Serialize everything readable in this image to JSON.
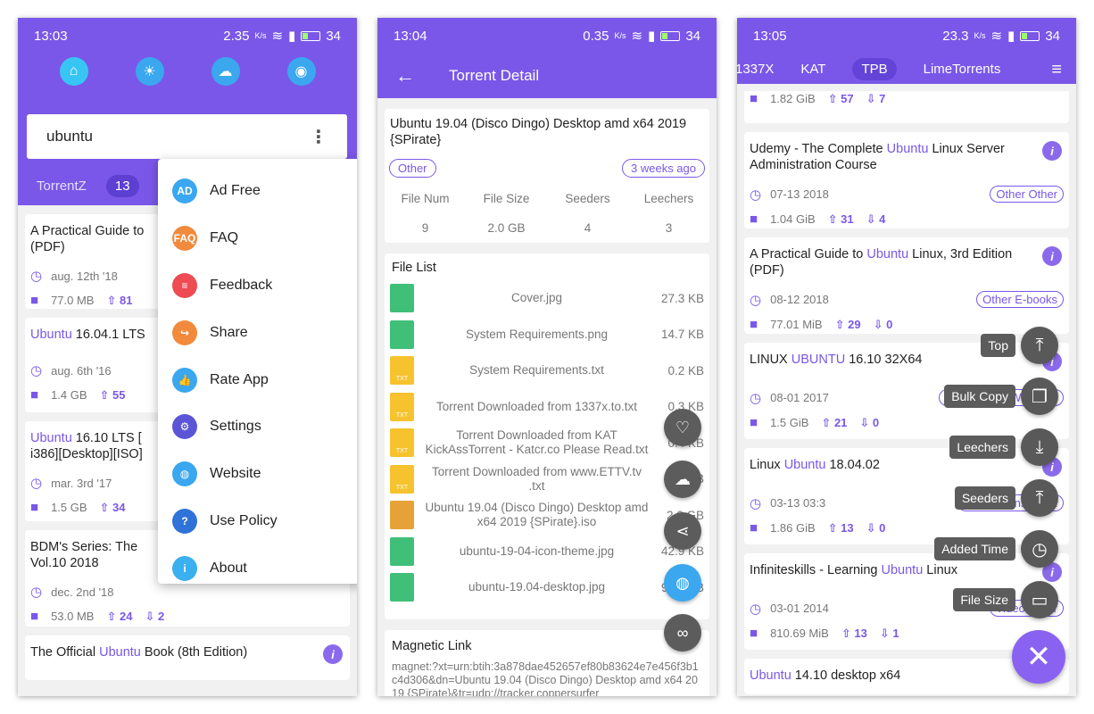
{
  "colors": {
    "primary": "#7a57e8",
    "accent": "#8a62f2",
    "fab_dark": "#595959"
  },
  "phone1": {
    "status": {
      "time": "13:03",
      "speed": "2.35",
      "speed_unit": "K/s",
      "battery": "34"
    },
    "top_icons": [
      "home-icon",
      "sun-icon",
      "weather-icon",
      "rss-icon"
    ],
    "search": {
      "value": "ubuntu"
    },
    "tabs": [
      {
        "label": "TorrentZ"
      },
      {
        "label": "13"
      }
    ],
    "menu": [
      {
        "label": "Ad Free",
        "icon": "ad-free-icon"
      },
      {
        "label": "FAQ",
        "icon": "faq-icon"
      },
      {
        "label": "Feedback",
        "icon": "feedback-icon"
      },
      {
        "label": "Share",
        "icon": "share-icon"
      },
      {
        "label": "Rate App",
        "icon": "rate-icon"
      },
      {
        "label": "Settings",
        "icon": "settings-icon"
      },
      {
        "label": "Website",
        "icon": "globe-icon"
      },
      {
        "label": "Use Policy",
        "icon": "help-icon"
      },
      {
        "label": "About",
        "icon": "about-icon"
      }
    ],
    "results": [
      {
        "title_pre": "A Practical Guide to",
        "title_hl": "",
        "title_post": "",
        "title2": "(PDF)",
        "date": "aug. 12th '18",
        "size": "77.0 MB",
        "seeds": "81",
        "leech": ""
      },
      {
        "title_pre": "",
        "title_hl": "Ubuntu",
        "title_post": " 16.04.1 LTS",
        "title2": "",
        "date": "aug. 6th '16",
        "size": "1.4 GB",
        "seeds": "55",
        "leech": ""
      },
      {
        "title_pre": "",
        "title_hl": "Ubuntu",
        "title_post": " 16.10 LTS [",
        "title2": "i386][Desktop][ISO]",
        "date": "mar. 3rd '17",
        "size": "1.5 GB",
        "seeds": "34",
        "leech": ""
      },
      {
        "title_pre": "BDM's Series: The",
        "title_hl": "",
        "title_post": "",
        "title2": "Vol.10 2018",
        "date": "dec. 2nd '18",
        "size": "53.0 MB",
        "seeds": "24",
        "leech": "2"
      }
    ],
    "last_result": {
      "title_pre": "The Official ",
      "title_hl": "Ubuntu",
      "title_post": " Book (8th Edition)"
    }
  },
  "phone2": {
    "status": {
      "time": "13:04",
      "speed": "0.35",
      "speed_unit": "K/s",
      "battery": "34"
    },
    "appbar_title": "Torrent Detail",
    "detail": {
      "title": "Ubuntu 19.04 (Disco Dingo) Desktop amd x64 2019 {SPirate}",
      "category": "Other",
      "age": "3 weeks ago",
      "headers": [
        "File Num",
        "File Size",
        "Seeders",
        "Leechers"
      ],
      "values": [
        "9",
        "2.0 GB",
        "4",
        "3"
      ]
    },
    "file_list_title": "File List",
    "files": [
      {
        "name": "Cover.jpg",
        "size": "27.3 KB",
        "type": "image"
      },
      {
        "name": "System Requirements.png",
        "size": "14.7 KB",
        "type": "image"
      },
      {
        "name": "System Requirements.txt",
        "size": "0.2 KB",
        "type": "text"
      },
      {
        "name": "Torrent Downloaded from 1337x.to.txt",
        "size": "0.3 KB",
        "type": "text"
      },
      {
        "name": "Torrent Downloaded from KAT KickAssTorrent - Katcr.co Please Read.txt",
        "size": "0.4 KB",
        "type": "text"
      },
      {
        "name": "Torrent Downloaded from www.ETTV.tv .txt",
        "size": "0.1 KB",
        "type": "text"
      },
      {
        "name": "Ubuntu 19.04 (Disco Dingo) Desktop amd x64 2019 {SPirate}.iso",
        "size": "2.0 GB",
        "type": "archive"
      },
      {
        "name": "ubuntu-19-04-icon-theme.jpg",
        "size": "42.9 KB",
        "type": "image"
      },
      {
        "name": "ubuntu-19.04-desktop.jpg",
        "size": "98.3 KB",
        "type": "image"
      }
    ],
    "file_type_labels": {
      "text": "TXT",
      "image": "",
      "archive": ""
    },
    "magnet_title": "Magnetic Link",
    "magnet": "magnet:?xt=urn:btih:3a878dae452657ef80b83624e7e456f3b1c4d306&dn=Ubuntu 19.04 (Disco Dingo) Desktop amd x64 2019 {SPirate}&tr=udp://tracker.coppersurfer",
    "fabs": [
      "heart-icon",
      "cloud-download-icon",
      "share-icon",
      "browser-icon",
      "link-icon"
    ]
  },
  "phone3": {
    "status": {
      "time": "13:05",
      "speed": "23.3",
      "speed_unit": "K/s",
      "battery": "34"
    },
    "tabs": [
      {
        "label": "1337X"
      },
      {
        "label": "KAT"
      },
      {
        "label": "TPB"
      },
      {
        "label": "LimeTorrents"
      }
    ],
    "top_partial": {
      "size": "1.82 GiB",
      "seeds": "57",
      "leech": "7"
    },
    "results": [
      {
        "title_pre": "Udemy - The Complete ",
        "title_hl": "Ubuntu",
        "title_post": " Linux Server",
        "title2": "Administration Course",
        "date": "07-13 2018",
        "tag": "Other Other",
        "size": "1.04 GiB",
        "seeds": "31",
        "leech": "4"
      },
      {
        "title_pre": "A Practical Guide to ",
        "title_hl": "Ubuntu",
        "title_post": " Linux, 3rd Edition",
        "title2": "(PDF)",
        "date": "08-12 2018",
        "tag": "Other E-books",
        "size": "77.01 MiB",
        "seeds": "29",
        "leech": "0"
      },
      {
        "title_pre": "LINUX ",
        "title_hl": "UBUNTU",
        "title_post": " 16.10 32X64",
        "title2": "",
        "date": "08-01 2017",
        "tag": "Applications Windows",
        "size": "1.5 GiB",
        "seeds": "21",
        "leech": "0"
      },
      {
        "title_pre": "Linux ",
        "title_hl": "Ubuntu",
        "title_post": " 18.04.02",
        "title2": "",
        "date": "03-13 03:3",
        "tag": "Applications UNIX",
        "size": "1.86 GiB",
        "seeds": "13",
        "leech": "0"
      },
      {
        "title_pre": "Infiniteskills - Learning ",
        "title_hl": "Ubuntu",
        "title_post": " Linux",
        "title2": "",
        "date": "03-01 2014",
        "tag": "Video Other",
        "size": "810.69 MiB",
        "seeds": "13",
        "leech": "1"
      }
    ],
    "last_result": {
      "title_hl": "Ubuntu",
      "title_post": " 14.10 desktop x64"
    },
    "speed_dial": [
      {
        "label": "Top",
        "icon": "arrow-top-icon"
      },
      {
        "label": "Bulk Copy",
        "icon": "copy-icon"
      },
      {
        "label": "Leechers",
        "icon": "download-icon"
      },
      {
        "label": "Seeders",
        "icon": "upload-icon"
      },
      {
        "label": "Added Time",
        "icon": "clock-icon"
      },
      {
        "label": "File Size",
        "icon": "folder-icon"
      }
    ]
  }
}
